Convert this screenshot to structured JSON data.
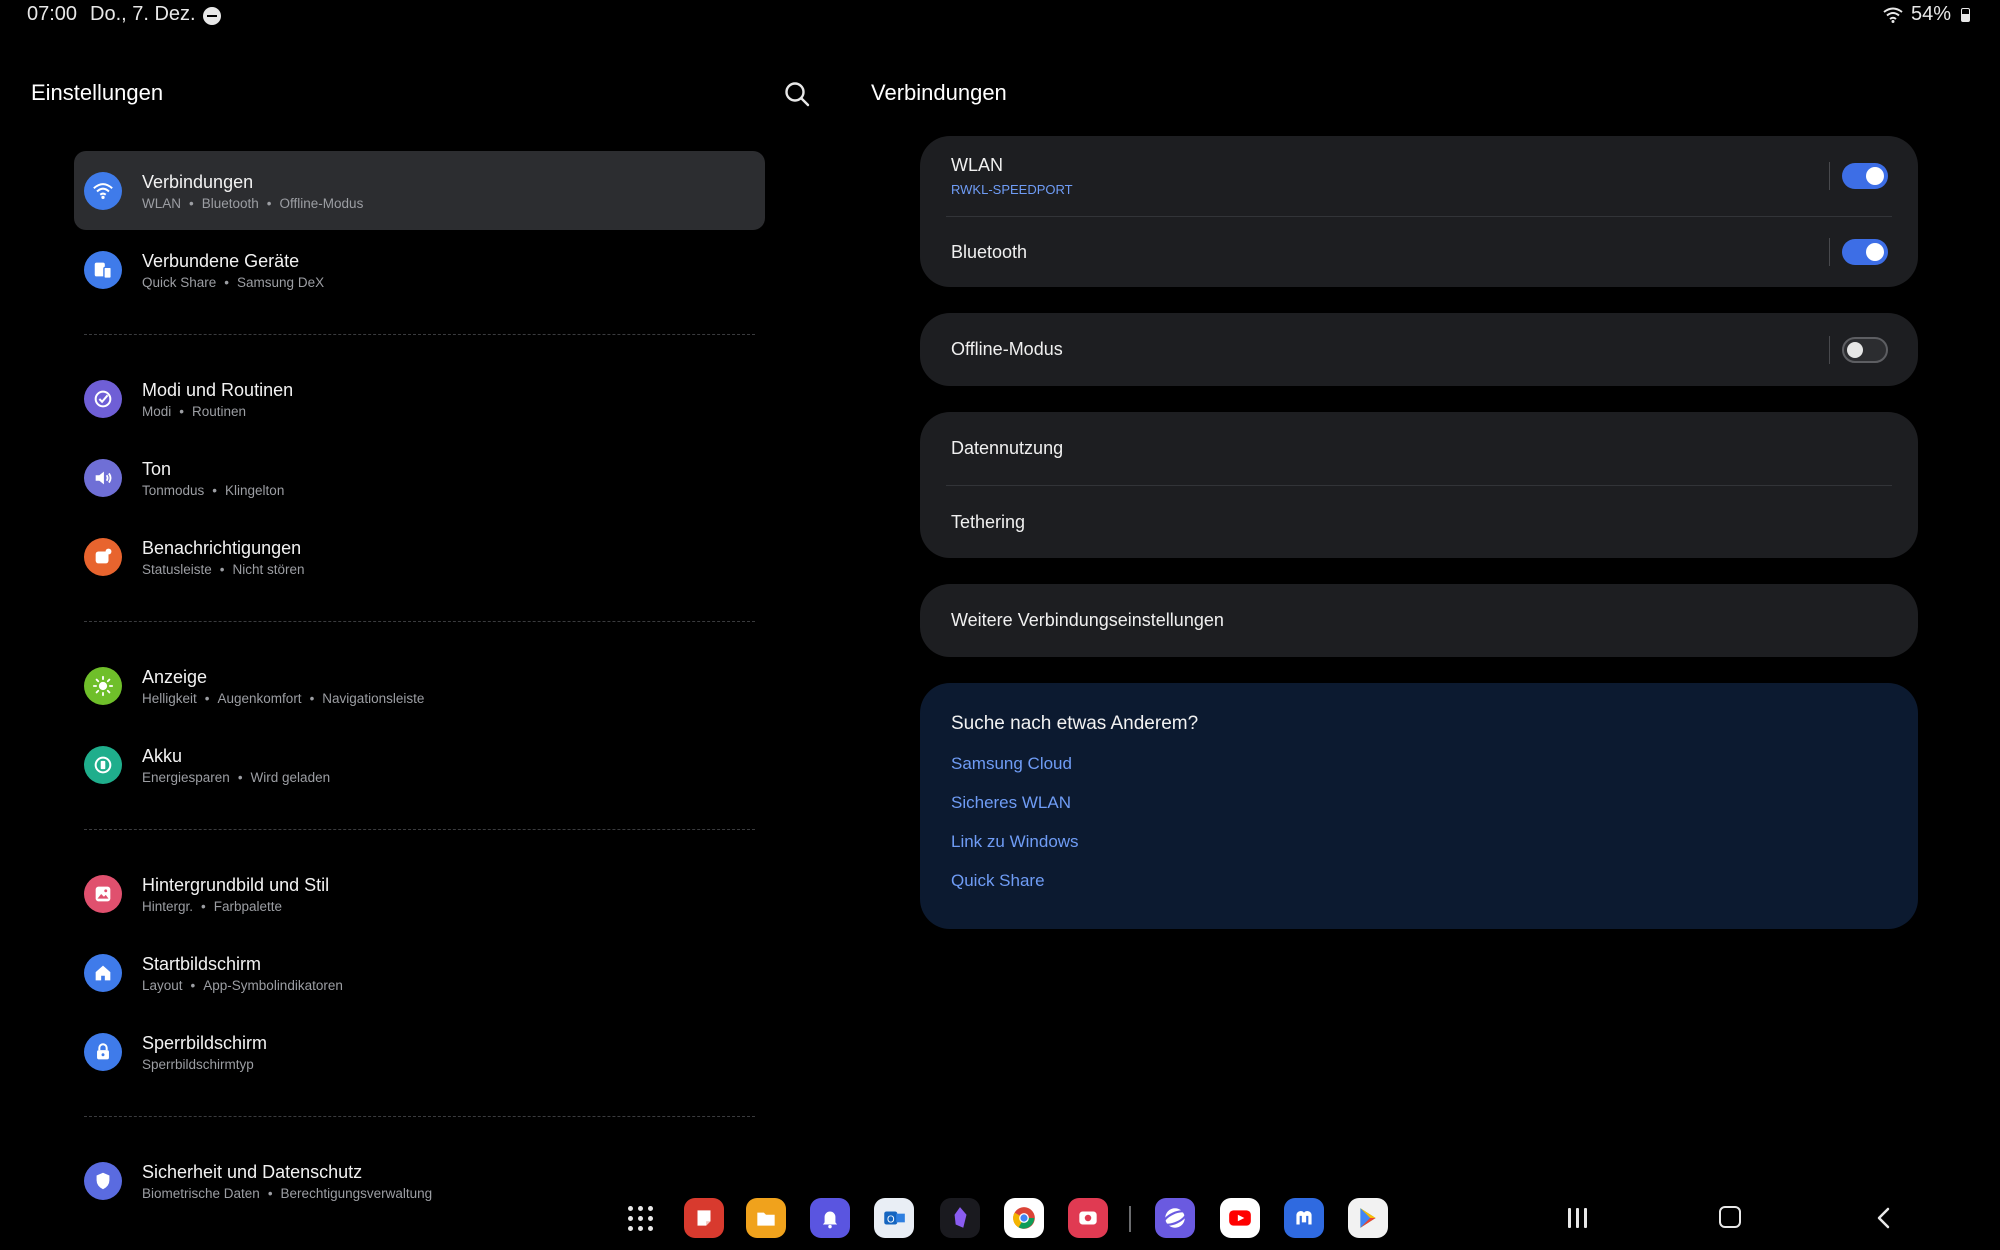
{
  "status_bar": {
    "time": "07:00",
    "date": "Do., 7. Dez.",
    "battery": "54%"
  },
  "left_pane": {
    "title": "Einstellungen",
    "groups": [
      [
        {
          "title": "Verbindungen",
          "subs": [
            "WLAN",
            "Bluetooth",
            "Offline-Modus"
          ],
          "icon": "wifi-icon",
          "color": "#3f7bea",
          "active": true
        },
        {
          "title": "Verbundene Geräte",
          "subs": [
            "Quick Share",
            "Samsung DeX"
          ],
          "icon": "devices-icon",
          "color": "#3f7bea"
        }
      ],
      [
        {
          "title": "Modi und Routinen",
          "subs": [
            "Modi",
            "Routinen"
          ],
          "icon": "check-circle-icon",
          "color": "#6f5fd6"
        },
        {
          "title": "Ton",
          "subs": [
            "Tonmodus",
            "Klingelton"
          ],
          "icon": "speaker-icon",
          "color": "#6f6fd6"
        },
        {
          "title": "Benachrichtigungen",
          "subs": [
            "Statusleiste",
            "Nicht stören"
          ],
          "icon": "notification-icon",
          "color": "#e8642e"
        }
      ],
      [
        {
          "title": "Anzeige",
          "subs": [
            "Helligkeit",
            "Augenkomfort",
            "Navigationsleiste"
          ],
          "icon": "sun-icon",
          "color": "#6fbf2a"
        },
        {
          "title": "Akku",
          "subs": [
            "Energiesparen",
            "Wird geladen"
          ],
          "icon": "battery-icon",
          "color": "#1fae8c"
        }
      ],
      [
        {
          "title": "Hintergrundbild und Stil",
          "subs": [
            "Hintergr.",
            "Farbpalette"
          ],
          "icon": "wallpaper-icon",
          "color": "#e0506e"
        },
        {
          "title": "Startbildschirm",
          "subs": [
            "Layout",
            "App-Symbolindikatoren"
          ],
          "icon": "home-icon",
          "color": "#3f7bea"
        },
        {
          "title": "Sperrbildschirm",
          "subs": [
            "Sperrbildschirmtyp"
          ],
          "icon": "lock-icon",
          "color": "#3f7bea"
        }
      ],
      [
        {
          "title": "Sicherheit und Datenschutz",
          "subs": [
            "Biometrische Daten",
            "Berechtigungsverwaltung"
          ],
          "icon": "shield-icon",
          "color": "#5a6be0"
        }
      ]
    ]
  },
  "right_pane": {
    "title": "Verbindungen",
    "wlan": {
      "title": "WLAN",
      "network": "RWKL-SPEEDPORT",
      "enabled": true
    },
    "bluetooth": {
      "title": "Bluetooth",
      "enabled": true
    },
    "offline": {
      "title": "Offline-Modus",
      "enabled": false
    },
    "data_usage": "Datennutzung",
    "tethering": "Tethering",
    "more": "Weitere Verbindungseinstellungen",
    "suggest": {
      "title": "Suche nach etwas Anderem?",
      "links": [
        "Samsung Cloud",
        "Sicheres WLAN",
        "Link zu Windows",
        "Quick Share"
      ]
    }
  },
  "dock": {
    "apps": [
      {
        "name": "samsung-notes-icon",
        "color": "#d83a2e"
      },
      {
        "name": "my-files-icon",
        "color": "#f0a21c"
      },
      {
        "name": "reminder-icon",
        "color": "#5a55e0"
      },
      {
        "name": "outlook-icon",
        "color": "#e9eef5"
      },
      {
        "name": "obsidian-icon",
        "color": "#1a1a1f"
      },
      {
        "name": "chrome-icon",
        "color": "#ffffff"
      },
      {
        "name": "screen-recorder-icon",
        "color": "#e03a52"
      },
      {
        "name": "samsung-internet-icon",
        "color": "#6a5ae0"
      },
      {
        "name": "youtube-icon",
        "color": "#ffffff"
      },
      {
        "name": "mastodon-icon",
        "color": "#2f6ae0"
      },
      {
        "name": "play-store-icon",
        "color": "#f2f2f2"
      }
    ]
  }
}
